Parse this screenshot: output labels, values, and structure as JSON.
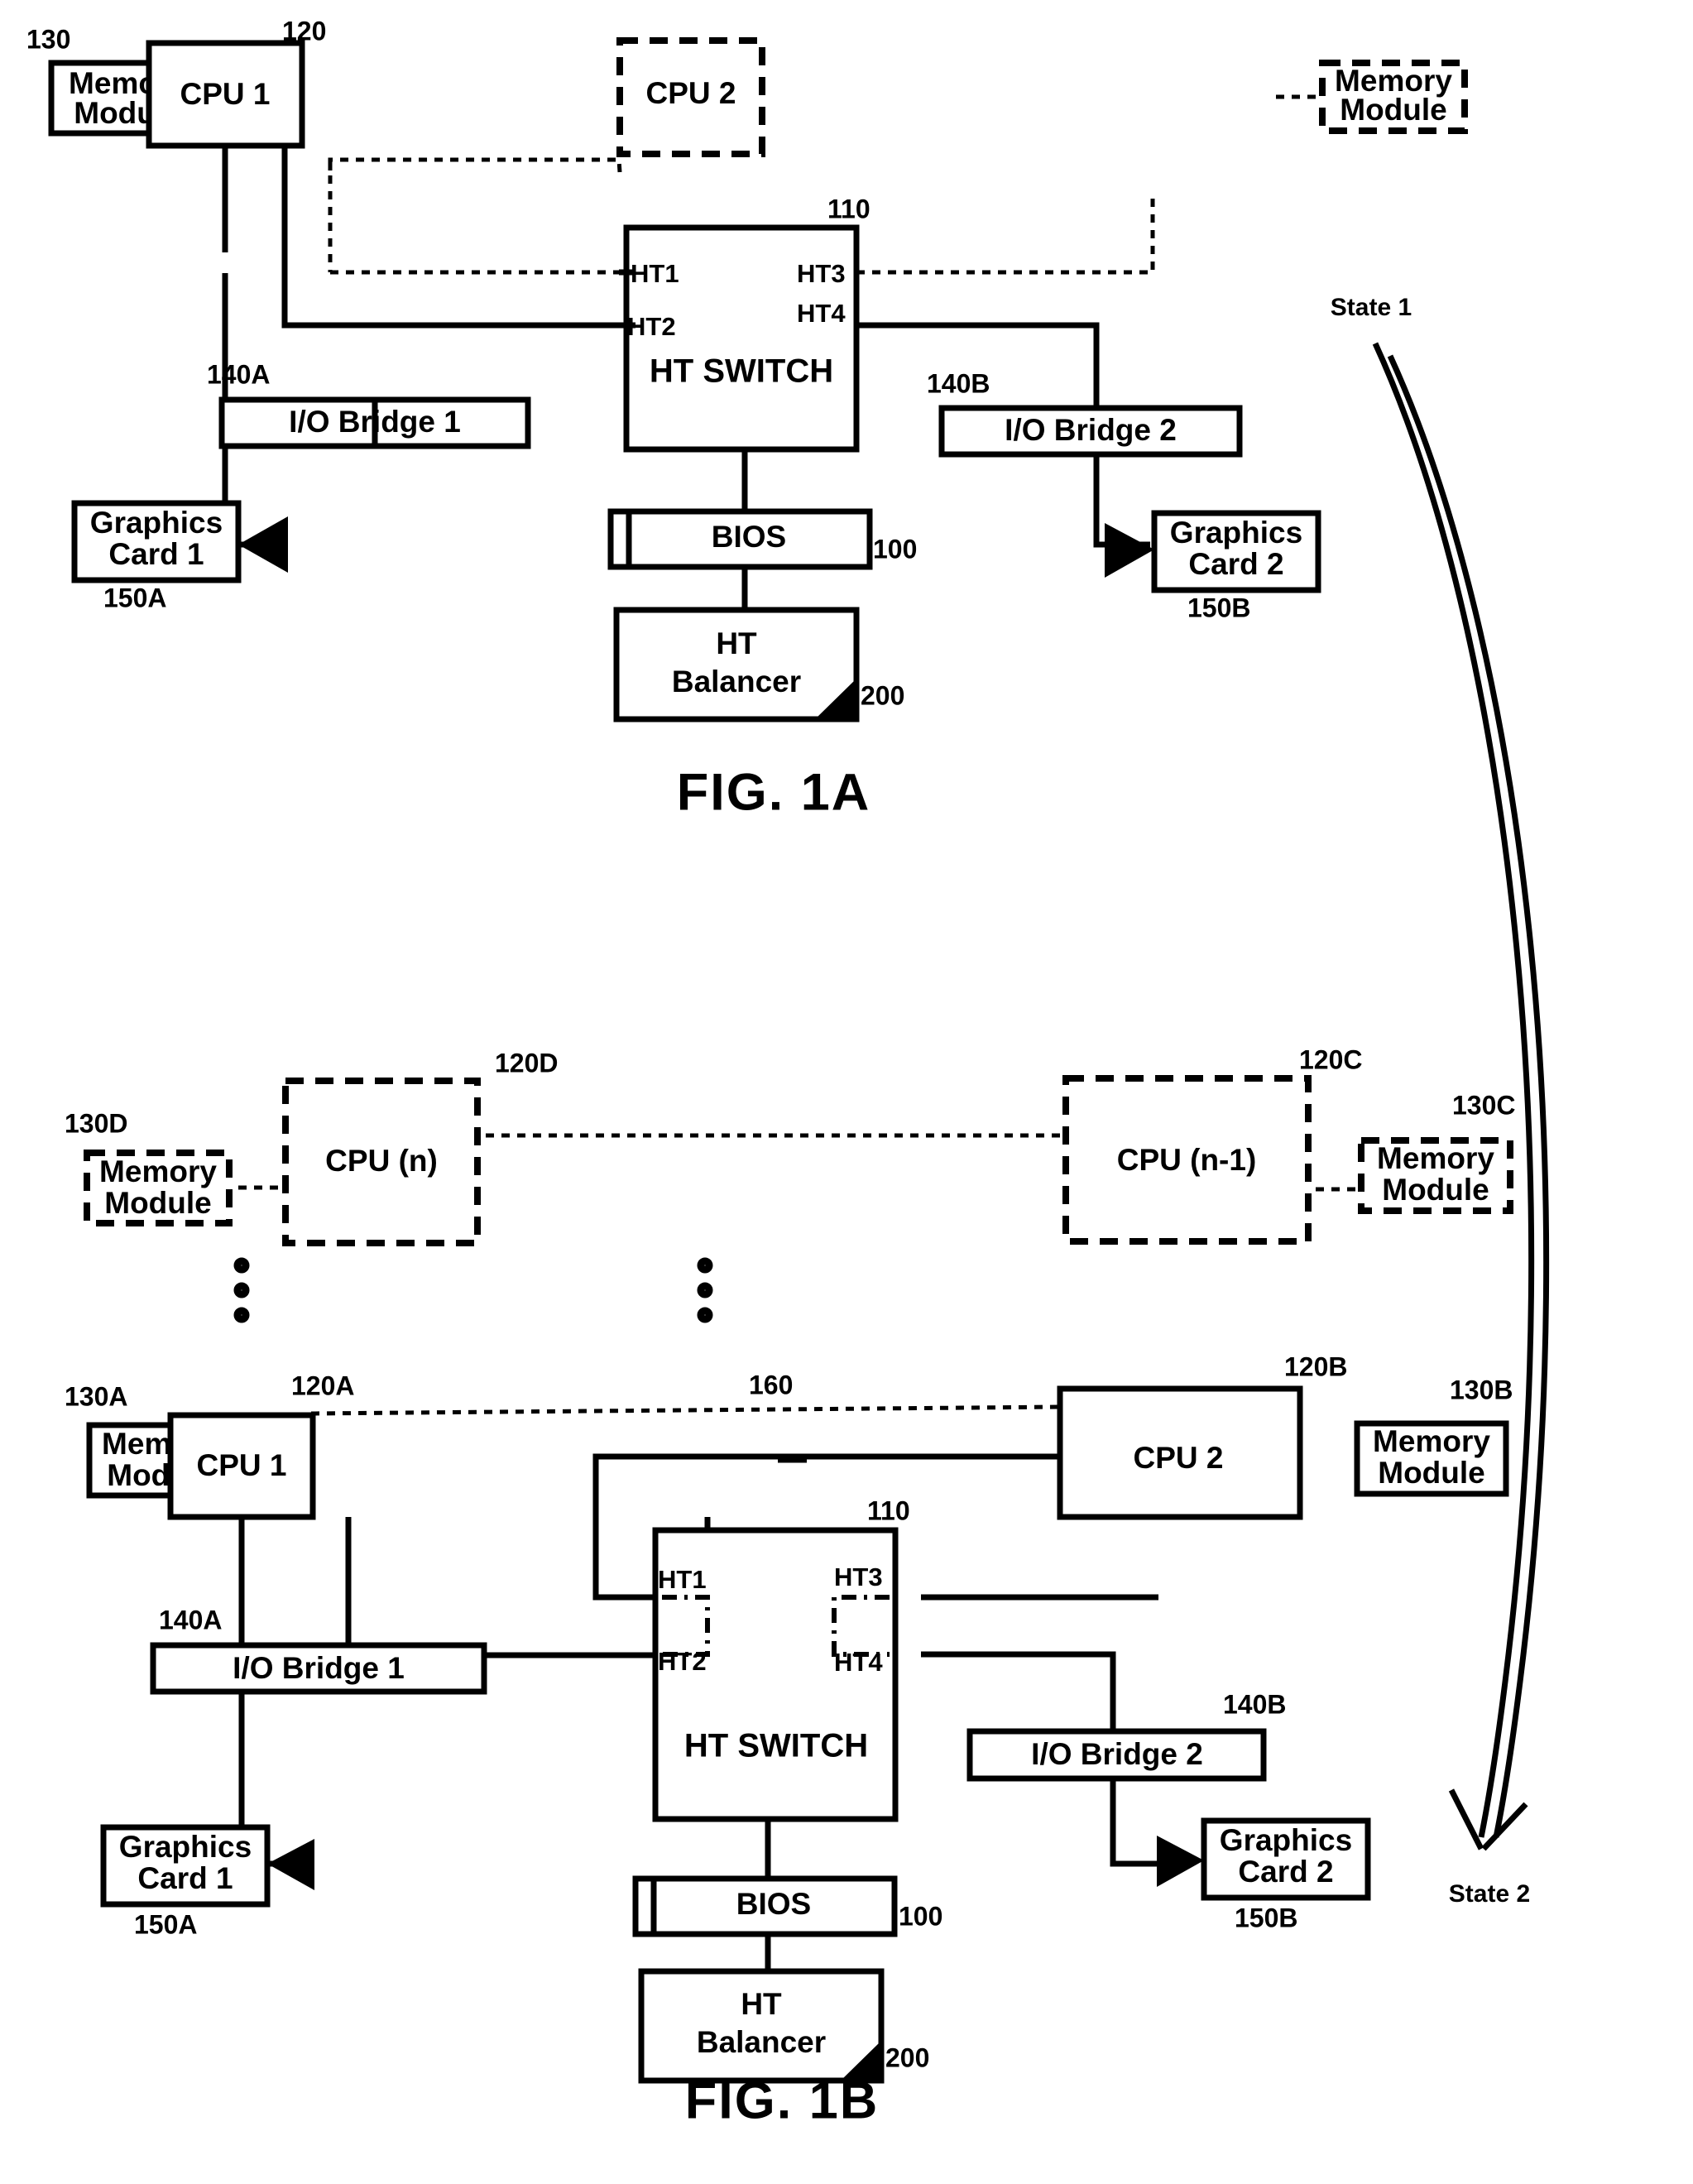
{
  "document": {
    "type": "patent-figure-sheet",
    "figures": [
      {
        "id": "fig1a",
        "caption": "FIG. 1A",
        "state_label": "State 1"
      },
      {
        "id": "fig1b",
        "caption": "FIG. 1B",
        "state_label": "State 2"
      }
    ]
  },
  "fig1a": {
    "caption": "FIG. 1A",
    "state_label": "State 1",
    "blocks": {
      "memory_module_1": {
        "line1": "Memory",
        "line2": "Module",
        "ref": "130",
        "style": "solid"
      },
      "cpu1": {
        "label": "CPU 1",
        "ref": "120",
        "style": "solid"
      },
      "cpu2": {
        "label": "CPU 2",
        "ref": "",
        "style": "dashed"
      },
      "memory_module_2": {
        "line1": "Memory",
        "line2": "Module",
        "ref": "",
        "style": "dashed"
      },
      "ht_switch": {
        "label": "HT SWITCH",
        "ref": "110",
        "style": "solid"
      },
      "io_bridge_1": {
        "label": "I/O Bridge 1",
        "ref": "140A",
        "style": "solid"
      },
      "io_bridge_2": {
        "label": "I/O Bridge 2",
        "ref": "140B",
        "style": "solid"
      },
      "graphics_card_1": {
        "line1": "Graphics",
        "line2": "Card 1",
        "ref": "150A",
        "style": "solid"
      },
      "graphics_card_2": {
        "line1": "Graphics",
        "line2": "Card 2",
        "ref": "150B",
        "style": "solid"
      },
      "bios": {
        "label": "BIOS",
        "ref": "100",
        "style": "solid"
      },
      "ht_balancer": {
        "line1": "HT",
        "line2": "Balancer",
        "ref": "200",
        "style": "solid"
      }
    },
    "ports": {
      "ht1": "HT1",
      "ht2": "HT2",
      "ht3": "HT3",
      "ht4": "HT4"
    }
  },
  "fig1b": {
    "caption": "FIG. 1B",
    "state_label": "State 2",
    "blocks": {
      "memory_module_d": {
        "line1": "Memory",
        "line2": "Module",
        "ref": "130D",
        "style": "dashed"
      },
      "cpu_n": {
        "label": "CPU (n)",
        "ref": "120D",
        "style": "dashed"
      },
      "cpu_n_minus_1": {
        "label": "CPU (n-1)",
        "ref": "120C",
        "style": "dashed"
      },
      "memory_module_c": {
        "line1": "Memory",
        "line2": "Module",
        "ref": "130C",
        "style": "dashed"
      },
      "memory_module_a": {
        "line1": "Memory",
        "line2": "Module",
        "ref": "130A",
        "style": "solid"
      },
      "cpu1": {
        "label": "CPU 1",
        "ref": "120A",
        "style": "solid"
      },
      "cpu2": {
        "label": "CPU 2",
        "ref": "120B",
        "style": "solid"
      },
      "memory_module_b": {
        "line1": "Memory",
        "line2": "Module",
        "ref": "130B",
        "style": "solid"
      },
      "ht_switch": {
        "label": "HT SWITCH",
        "ref": "110",
        "style": "solid"
      },
      "io_bridge_1": {
        "label": "I/O Bridge 1",
        "ref": "140A",
        "style": "solid"
      },
      "io_bridge_2": {
        "label": "I/O Bridge 2",
        "ref": "140B",
        "style": "solid"
      },
      "graphics_card_1": {
        "line1": "Graphics",
        "line2": "Card 1",
        "ref": "150A",
        "style": "solid"
      },
      "graphics_card_2": {
        "line1": "Graphics",
        "line2": "Card 2",
        "ref": "150B",
        "style": "solid"
      },
      "bios": {
        "label": "BIOS",
        "ref": "100",
        "style": "solid"
      },
      "ht_balancer": {
        "line1": "HT",
        "line2": "Balancer",
        "ref": "200",
        "style": "solid"
      }
    },
    "ports": {
      "ht1": "HT1",
      "ht2": "HT2",
      "ht3": "HT3",
      "ht4": "HT4"
    },
    "links": {
      "cpu_interconnect_ref": "160"
    }
  },
  "colors": {
    "ink": "#000000",
    "paper": "#ffffff"
  }
}
